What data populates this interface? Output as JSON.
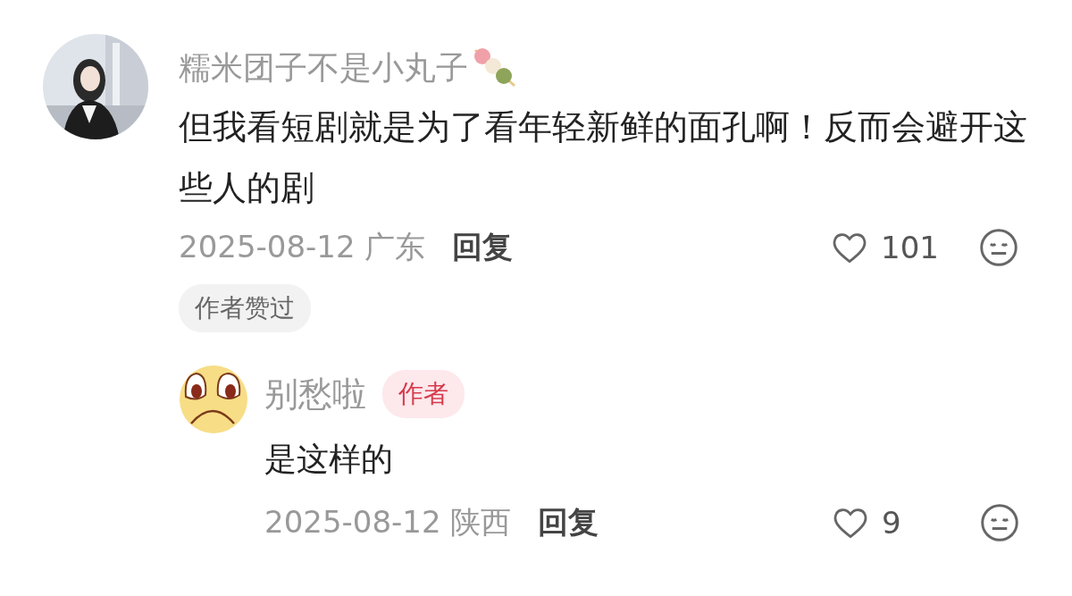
{
  "comment": {
    "author": "糯米团子不是小丸子",
    "text": "但我看短剧就是为了看年轻新鲜的面孔啊！反而会避开这些人的剧",
    "date": "2025-08-12",
    "location": "广东",
    "reply_label": "回复",
    "likes": "101",
    "author_liked_badge": "作者赞过",
    "reply": {
      "author": "别愁啦",
      "author_badge": "作者",
      "text": "是这样的",
      "date": "2025-08-12",
      "location": "陕西",
      "reply_label": "回复",
      "likes": "9"
    }
  }
}
